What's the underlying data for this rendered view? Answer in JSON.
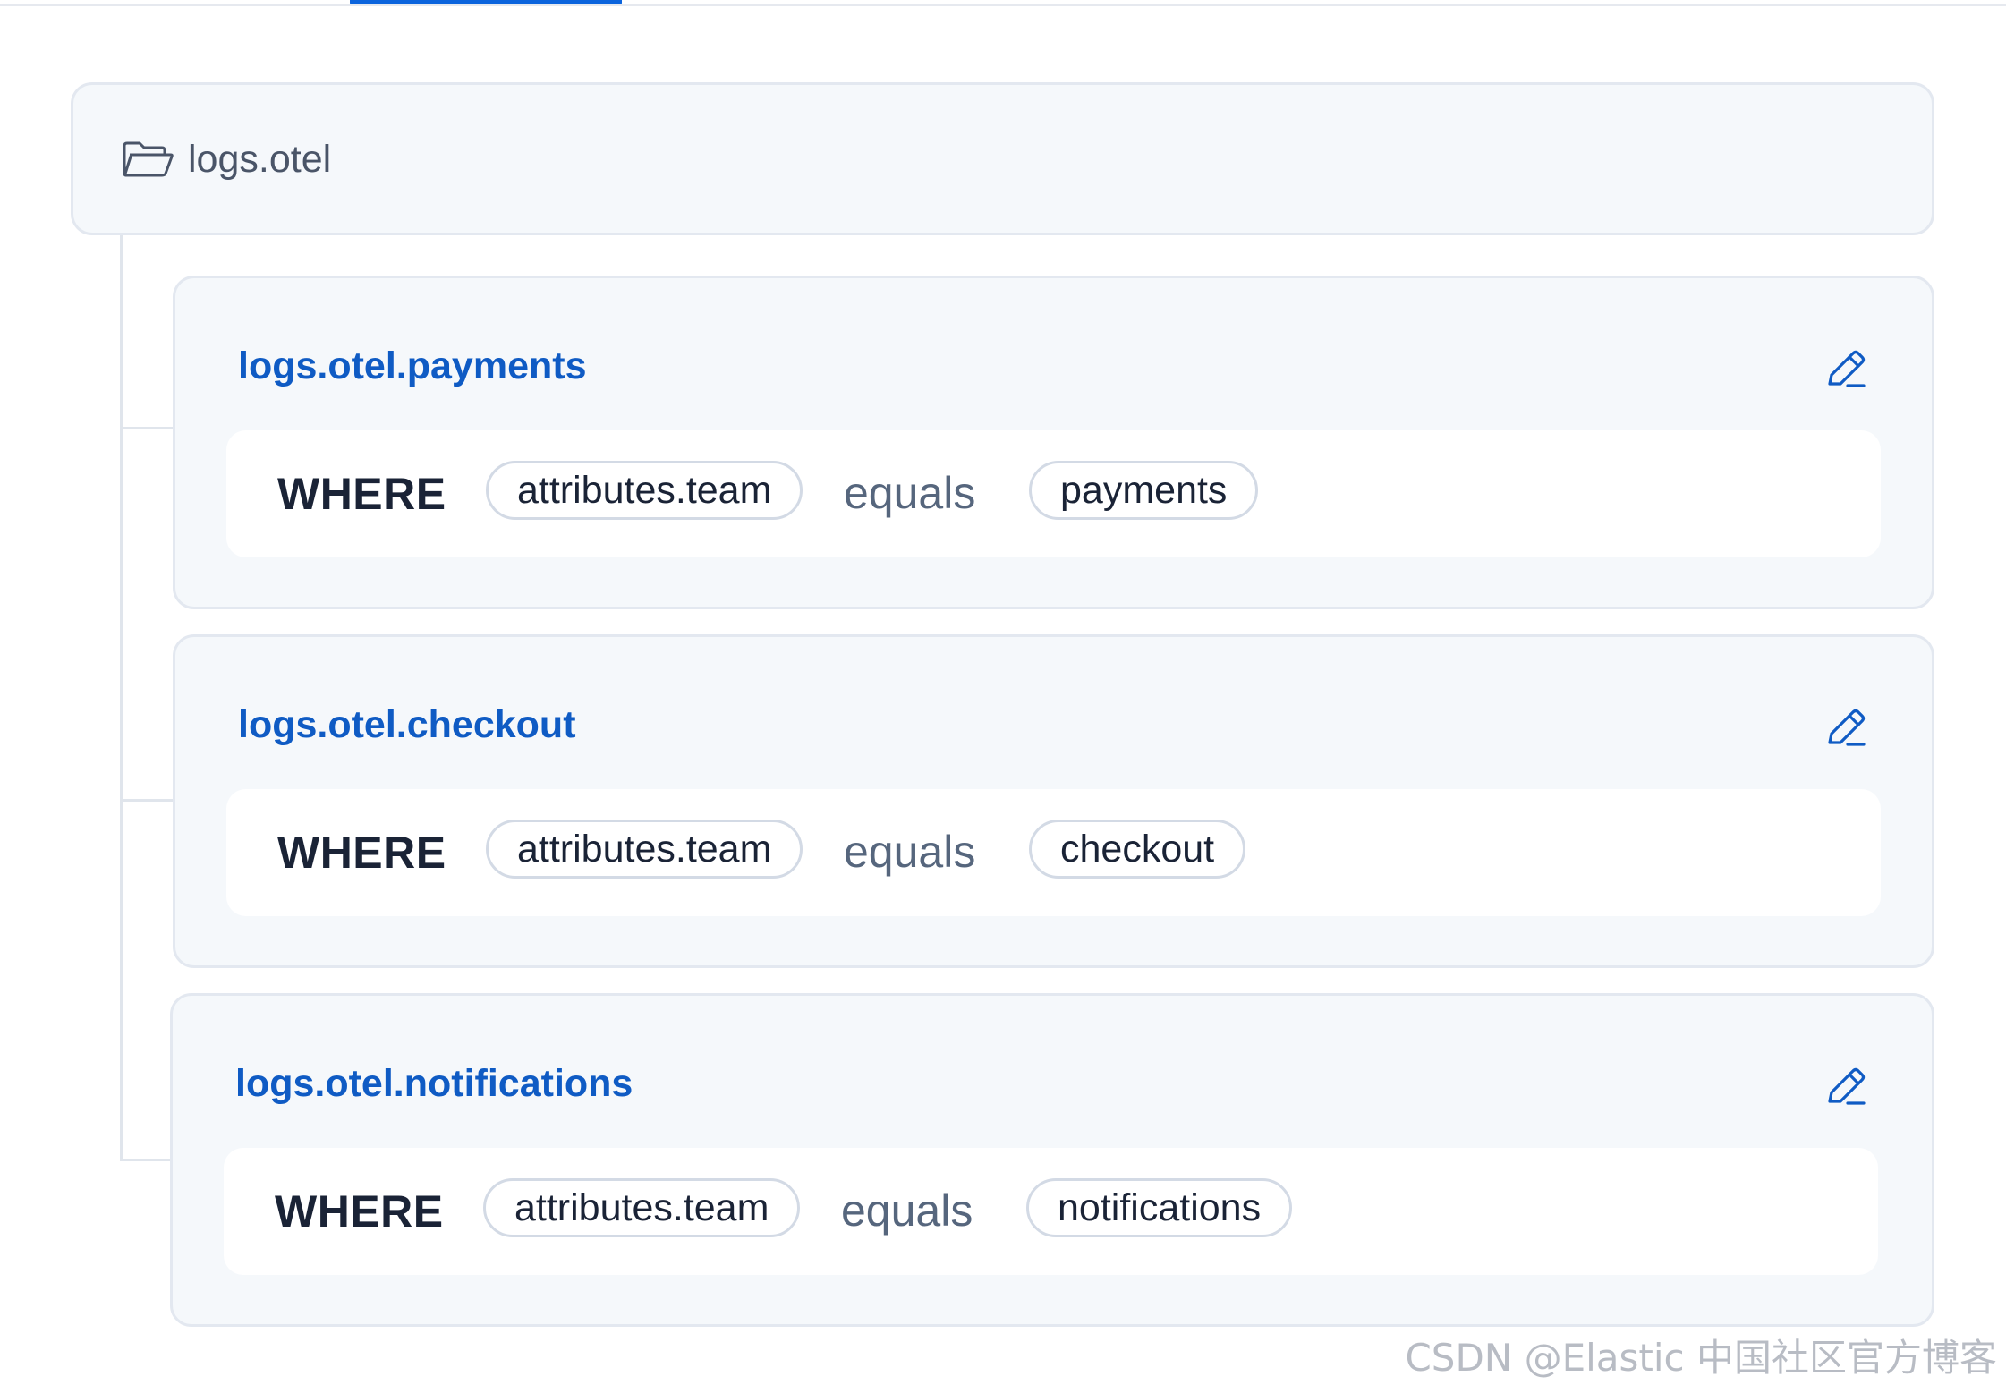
{
  "parent": {
    "name": "logs.otel",
    "icon": "folder-open-icon"
  },
  "children": [
    {
      "name": "logs.otel.payments",
      "condition": {
        "keyword": "WHERE",
        "field": "attributes.team",
        "operator": "equals",
        "value": "payments"
      },
      "edit_icon": "pencil-icon"
    },
    {
      "name": "logs.otel.checkout",
      "condition": {
        "keyword": "WHERE",
        "field": "attributes.team",
        "operator": "equals",
        "value": "checkout"
      },
      "edit_icon": "pencil-icon"
    },
    {
      "name": "logs.otel.notifications",
      "condition": {
        "keyword": "WHERE",
        "field": "attributes.team",
        "operator": "equals",
        "value": "notifications"
      },
      "edit_icon": "pencil-icon"
    }
  ],
  "watermark": "CSDN @Elastic 中国社区官方博客",
  "colors": {
    "accent": "#0b64dd",
    "link": "#0f5bc4",
    "card_bg": "#f5f8fb",
    "border": "#e3e8f0"
  }
}
